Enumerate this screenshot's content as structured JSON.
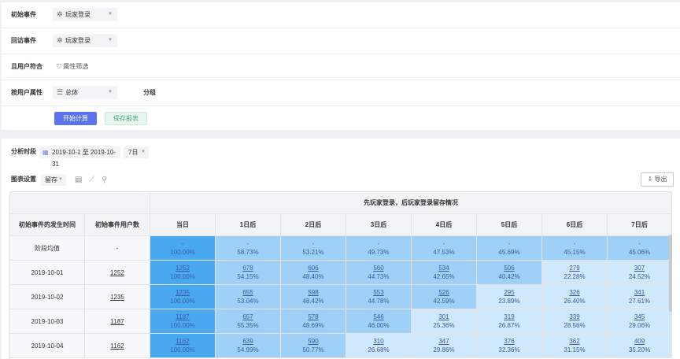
{
  "filters": {
    "initial_event": {
      "label": "初始事件",
      "value": "玩家登录",
      "icon": "sparkle-icon"
    },
    "return_event": {
      "label": "回访事件",
      "value": "玩家登录",
      "icon": "sparkle-icon"
    },
    "user_match": {
      "label": "且用户符合",
      "link": "属性筛选",
      "icon": "funnel-icon"
    },
    "user_attr": {
      "label": "按用户属性",
      "value": "总体",
      "group_label": "分组",
      "icon": "list-icon"
    },
    "start_button": "开始计算",
    "save_button": "保存报表"
  },
  "analysis": {
    "period_label": "分析时段",
    "date_range": "2019-10-1 至 2019-10-31",
    "time_span": "7日",
    "chart_settings_label": "图表设置",
    "chart_mode": "留存",
    "export_label": "导出"
  },
  "table": {
    "group_header": "先玩家登录，后玩家登录留存情况",
    "col_date": "初始事件的发生时间",
    "col_users": "初始事件用户数",
    "day_cols": [
      "当日",
      "1日后",
      "2日后",
      "3日后",
      "4日后",
      "5日后",
      "6日后",
      "7日后"
    ],
    "rows": [
      {
        "date": "阶段均值",
        "users": "-",
        "cells": [
          {
            "c": "-",
            "p": "100.00%"
          },
          {
            "c": "-",
            "p": "58.73%"
          },
          {
            "c": "-",
            "p": "53.21%"
          },
          {
            "c": "-",
            "p": "49.73%"
          },
          {
            "c": "-",
            "p": "47.53%"
          },
          {
            "c": "-",
            "p": "45.69%"
          },
          {
            "c": "-",
            "p": "45.15%"
          },
          {
            "c": "-",
            "p": "45.06%"
          }
        ]
      },
      {
        "date": "2019-10-01",
        "users": "1252",
        "cells": [
          {
            "c": "1252",
            "p": "100.00%"
          },
          {
            "c": "678",
            "p": "54.15%"
          },
          {
            "c": "606",
            "p": "48.40%"
          },
          {
            "c": "560",
            "p": "44.73%"
          },
          {
            "c": "534",
            "p": "42.65%"
          },
          {
            "c": "506",
            "p": "40.42%"
          },
          {
            "c": "279",
            "p": "22.28%"
          },
          {
            "c": "307",
            "p": "24.52%"
          }
        ]
      },
      {
        "date": "2019-10-02",
        "users": "1235",
        "cells": [
          {
            "c": "1235",
            "p": "100.00%"
          },
          {
            "c": "655",
            "p": "53.04%"
          },
          {
            "c": "598",
            "p": "48.42%"
          },
          {
            "c": "553",
            "p": "44.78%"
          },
          {
            "c": "526",
            "p": "42.59%"
          },
          {
            "c": "295",
            "p": "23.89%"
          },
          {
            "c": "326",
            "p": "26.40%"
          },
          {
            "c": "341",
            "p": "27.61%"
          }
        ]
      },
      {
        "date": "2019-10-03",
        "users": "1187",
        "cells": [
          {
            "c": "1187",
            "p": "100.00%"
          },
          {
            "c": "657",
            "p": "55.35%"
          },
          {
            "c": "578",
            "p": "48.69%"
          },
          {
            "c": "546",
            "p": "46.00%"
          },
          {
            "c": "301",
            "p": "25.36%"
          },
          {
            "c": "319",
            "p": "26.87%"
          },
          {
            "c": "339",
            "p": "28.56%"
          },
          {
            "c": "345",
            "p": "29.06%"
          }
        ]
      },
      {
        "date": "2019-10-04",
        "users": "1162",
        "cells": [
          {
            "c": "1162",
            "p": "100.00%"
          },
          {
            "c": "639",
            "p": "54.99%"
          },
          {
            "c": "590",
            "p": "50.77%"
          },
          {
            "c": "310",
            "p": "26.68%"
          },
          {
            "c": "347",
            "p": "29.86%"
          },
          {
            "c": "376",
            "p": "32.36%"
          },
          {
            "c": "362",
            "p": "31.15%"
          },
          {
            "c": "409",
            "p": "35.20%"
          }
        ]
      }
    ]
  },
  "colors": {
    "primary": "#5b74ee",
    "heat_full": "#4aa8f0",
    "heat_high": "#9fd0f7",
    "heat_low": "#cfe8fb"
  }
}
